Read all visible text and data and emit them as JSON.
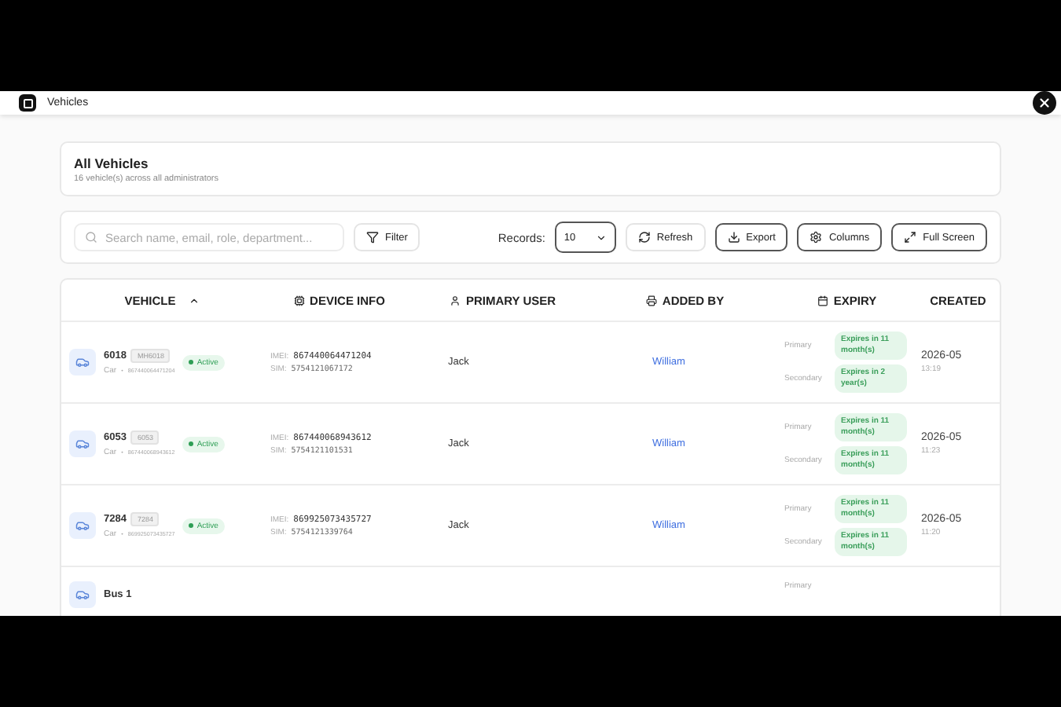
{
  "app_bar": {
    "title": "Vehicles"
  },
  "summary": {
    "title": "All Vehicles",
    "subtitle": "16 vehicle(s) across all administrators"
  },
  "toolbar": {
    "search": {
      "placeholder": "Search name, email, role, department..."
    },
    "filter": "Filter",
    "records_label": "Records:",
    "records_value": "10",
    "buttons": [
      {
        "kind": "refresh",
        "label": "Refresh",
        "outlined": false
      },
      {
        "kind": "export",
        "label": "Export",
        "outlined": true
      },
      {
        "kind": "columns",
        "label": "Columns",
        "outlined": true
      },
      {
        "kind": "fullscreen",
        "label": "Full Screen",
        "outlined": true
      }
    ]
  },
  "table": {
    "columns": [
      {
        "kind": "vehicle",
        "label": "VEHICLE",
        "sorted": true
      },
      {
        "kind": "device",
        "label": "DEVICE INFO",
        "sorted": false
      },
      {
        "kind": "user",
        "label": "PRIMARY USER",
        "sorted": false
      },
      {
        "kind": "added",
        "label": "ADDED BY",
        "sorted": false
      },
      {
        "kind": "expiry",
        "label": "EXPIRY",
        "sorted": false
      },
      {
        "kind": "created",
        "label": "CREATED",
        "sorted": false
      }
    ],
    "rows": [
      {
        "name": "6018",
        "plate": "MH6018",
        "type": "Car",
        "separator": "•",
        "number": "867440064471204",
        "status": "Active",
        "active": true,
        "imei_label": "IMEI:",
        "imei": "867440064471204",
        "sim_label": "SIM:",
        "sim": "5754121067172",
        "primary_user": "Jack",
        "added_by": "William",
        "expiry": [
          {
            "label": "Primary",
            "text": "Expires in 11 month(s)"
          },
          {
            "label": "Secondary",
            "text": "Expires in 2 year(s)"
          }
        ],
        "created_date": "2026-05",
        "created_time": "13:19"
      },
      {
        "name": "6053",
        "plate": "6053",
        "type": "Car",
        "separator": "•",
        "number": "867440068943612",
        "status": "Active",
        "active": true,
        "imei_label": "IMEI:",
        "imei": "867440068943612",
        "sim_label": "SIM:",
        "sim": "5754121101531",
        "primary_user": "Jack",
        "added_by": "William",
        "expiry": [
          {
            "label": "Primary",
            "text": "Expires in 11 month(s)"
          },
          {
            "label": "Secondary",
            "text": "Expires in 11 month(s)"
          }
        ],
        "created_date": "2026-05",
        "created_time": "11:23"
      },
      {
        "name": "7284",
        "plate": "7284",
        "type": "Car",
        "separator": "•",
        "number": "869925073435727",
        "status": "Active",
        "active": true,
        "imei_label": "IMEI:",
        "imei": "869925073435727",
        "sim_label": "SIM:",
        "sim": "5754121339764",
        "primary_user": "Jack",
        "added_by": "William",
        "expiry": [
          {
            "label": "Primary",
            "text": "Expires in 11 month(s)"
          },
          {
            "label": "Secondary",
            "text": "Expires in 11 month(s)"
          }
        ],
        "created_date": "2026-05",
        "created_time": "11:20"
      },
      {
        "name": "Bus 1",
        "expiry": [
          {
            "label": "Primary"
          }
        ]
      }
    ]
  }
}
